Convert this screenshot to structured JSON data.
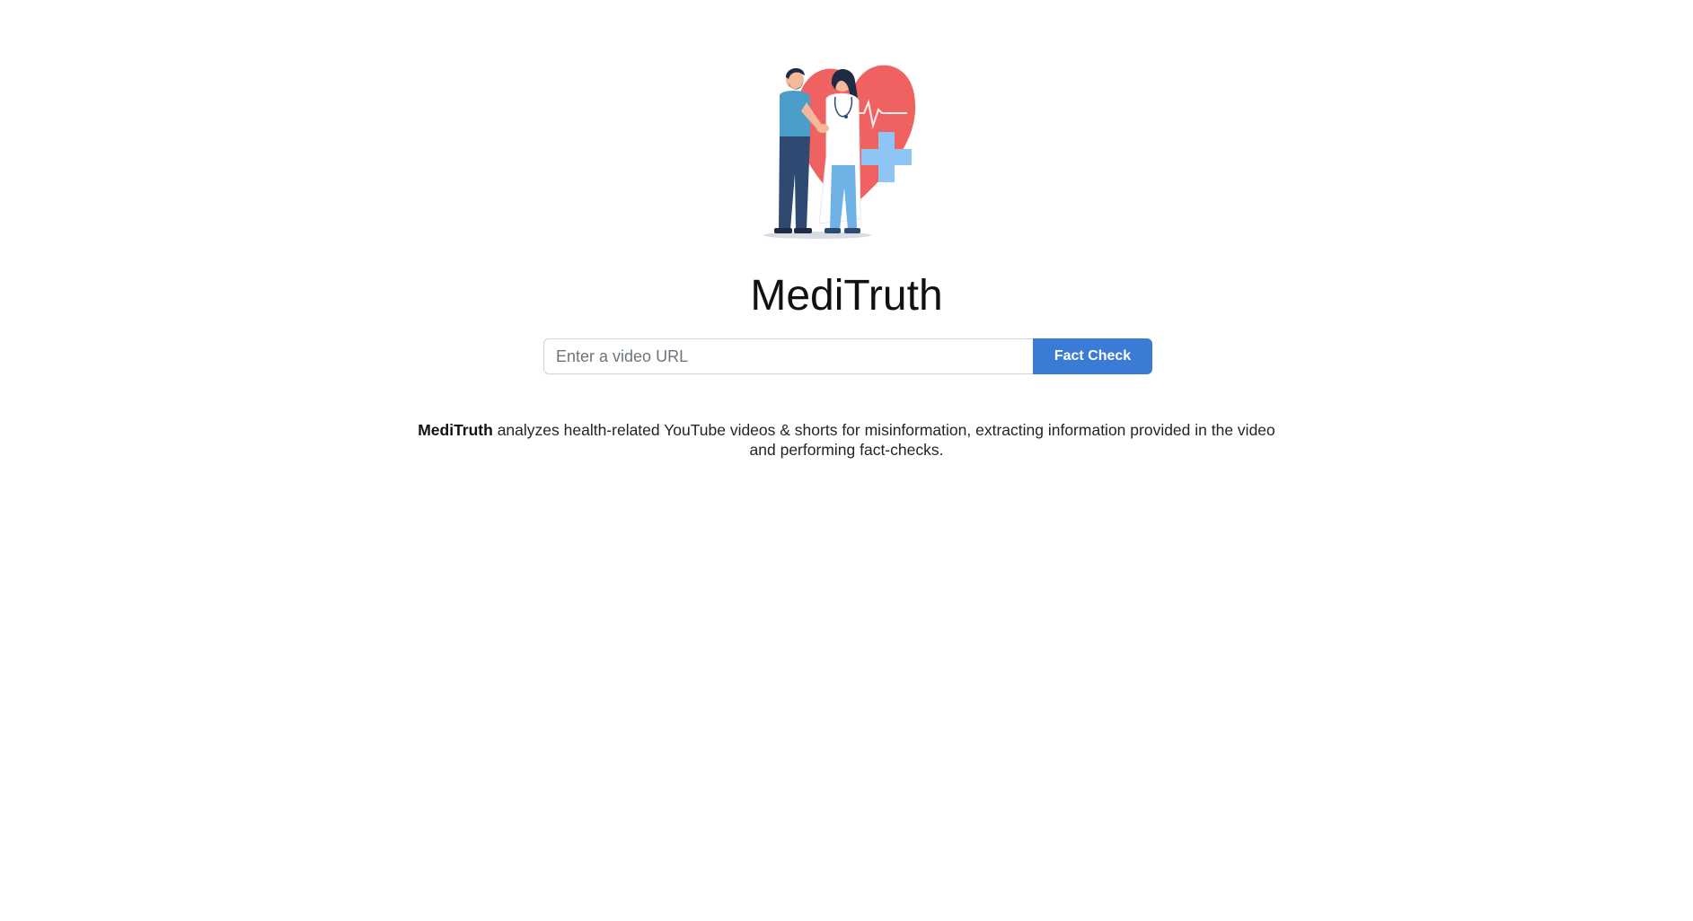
{
  "hero": {
    "image_name": "doctor-patient-heart-illustration",
    "colors": {
      "heart": "#f06262",
      "cross": "#8ec5f4",
      "patient_shirt": "#4a9ec9",
      "patient_pants": "#2f4a72",
      "doctor_coat": "#ffffff",
      "doctor_pants": "#6fb2e6",
      "hair": "#1f2a44"
    }
  },
  "title": "MediTruth",
  "search": {
    "placeholder": "Enter a video URL",
    "value": "",
    "button_label": "Fact Check",
    "button_color": "#3a7bd5"
  },
  "description": {
    "brand": "MediTruth",
    "text": " analyzes health-related YouTube videos & shorts for misinformation, extracting information provided in the video and performing fact-checks."
  }
}
